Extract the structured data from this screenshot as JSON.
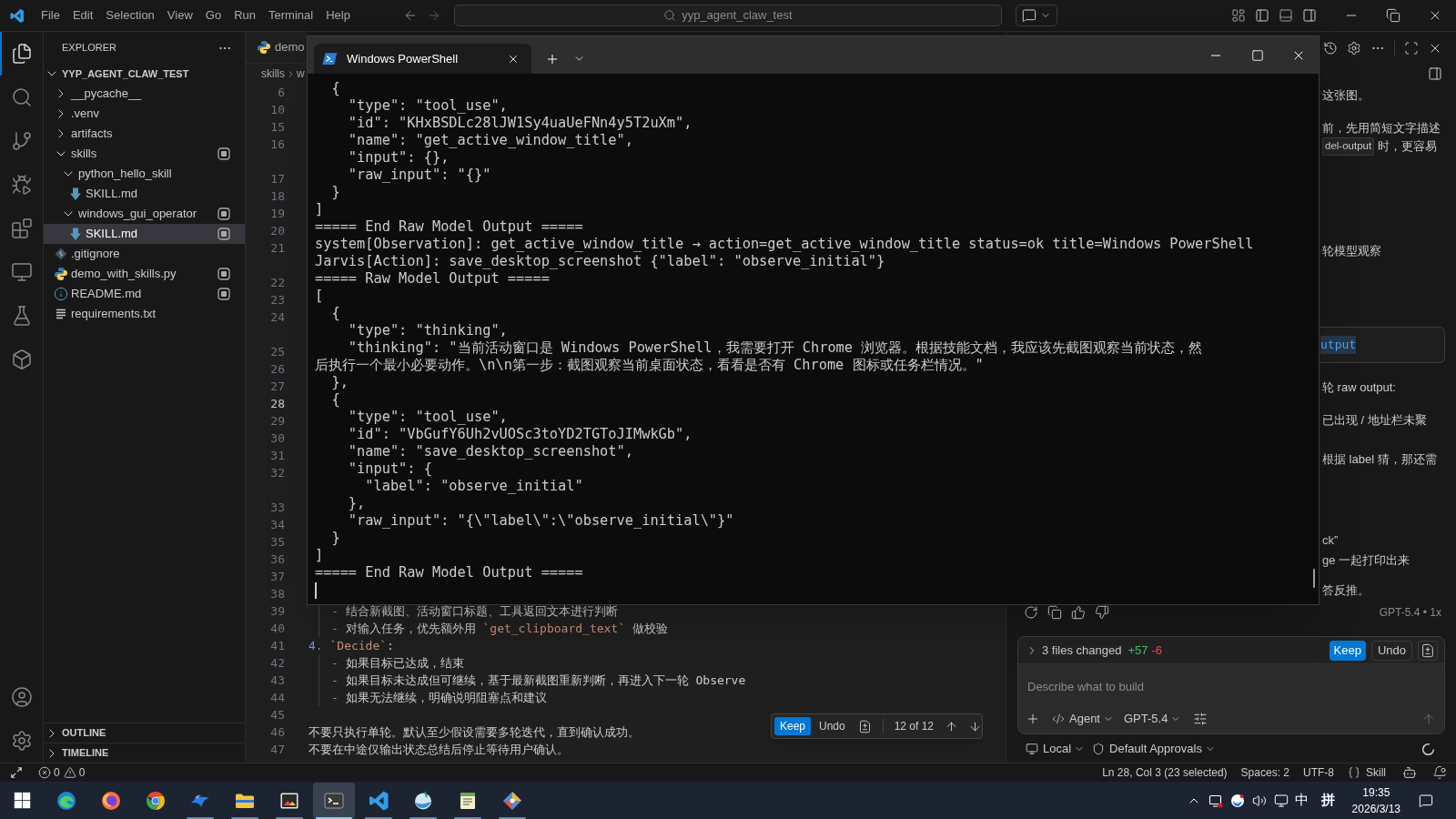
{
  "titlebar": {
    "menu": [
      "File",
      "Edit",
      "Selection",
      "View",
      "Go",
      "Run",
      "Terminal",
      "Help"
    ],
    "search": "yyp_agent_claw_test"
  },
  "activity_bar": [
    {
      "selected": true
    },
    {
      "selected": false
    },
    {
      "selected": false
    },
    {
      "selected": false
    },
    {
      "selected": false
    },
    {
      "selected": false
    },
    {
      "selected": false
    },
    {
      "selected": false
    }
  ],
  "explorer": {
    "title": "EXPLORER",
    "root": {
      "label": "YYP_AGENT_CLAW_TEST",
      "expanded": true
    },
    "items": [
      {
        "label": "__pycache__",
        "kind": "folder",
        "expanded": false,
        "selected": false,
        "badge": false
      },
      {
        "label": ".venv",
        "kind": "folder",
        "expanded": false,
        "selected": false,
        "badge": false
      },
      {
        "label": "artifacts",
        "kind": "folder",
        "expanded": false,
        "selected": false,
        "badge": false
      },
      {
        "label": "skills",
        "kind": "folder",
        "expanded": true,
        "selected": false,
        "badge": true,
        "children": [
          {
            "label": "python_hello_skill",
            "kind": "folder",
            "expanded": true,
            "selected": false,
            "badge": false,
            "children": [
              {
                "label": "SKILL.md",
                "kind": "markdown",
                "selected": false,
                "badge": false
              }
            ]
          },
          {
            "label": "windows_gui_operator",
            "kind": "folder",
            "expanded": true,
            "selected": false,
            "badge": true,
            "children": [
              {
                "label": "SKILL.md",
                "kind": "markdown",
                "selected": true,
                "badge": true
              }
            ]
          }
        ]
      },
      {
        "label": ".gitignore",
        "kind": "git",
        "selected": false,
        "badge": false
      },
      {
        "label": "demo_with_skills.py",
        "kind": "python",
        "selected": false,
        "badge": true
      },
      {
        "label": "README.md",
        "kind": "info",
        "selected": false,
        "badge": true
      },
      {
        "label": "requirements.txt",
        "kind": "text",
        "selected": false,
        "badge": false
      }
    ],
    "sections": [
      {
        "label": "OUTLINE",
        "expanded": false
      },
      {
        "label": "TIMELINE",
        "expanded": false
      }
    ]
  },
  "editor": {
    "tab": "demo",
    "breadcrumb": [
      "skills",
      "w"
    ],
    "rows": [
      {
        "kind": "line",
        "number": "6",
        "current": false
      },
      {
        "kind": "line",
        "number": "10",
        "current": false
      },
      {
        "kind": "line",
        "number": "15",
        "current": false
      },
      {
        "kind": "line",
        "number": "16",
        "current": false
      },
      {
        "kind": "wrap"
      },
      {
        "kind": "line",
        "number": "17",
        "current": false
      },
      {
        "kind": "line",
        "number": "18",
        "current": false
      },
      {
        "kind": "line",
        "number": "19",
        "current": false
      },
      {
        "kind": "line",
        "number": "20",
        "current": false
      },
      {
        "kind": "line",
        "number": "21",
        "current": false
      },
      {
        "kind": "wrap"
      },
      {
        "kind": "line",
        "number": "22",
        "current": false
      },
      {
        "kind": "line",
        "number": "23",
        "current": false
      },
      {
        "kind": "line",
        "number": "24",
        "current": false
      },
      {
        "kind": "wrap"
      },
      {
        "kind": "line",
        "number": "25",
        "current": false
      },
      {
        "kind": "line",
        "number": "26",
        "current": false
      },
      {
        "kind": "line",
        "number": "27",
        "current": false
      },
      {
        "kind": "line",
        "number": "28",
        "current": true
      },
      {
        "kind": "line",
        "number": "29",
        "current": false
      },
      {
        "kind": "line",
        "number": "30",
        "current": false
      },
      {
        "kind": "line",
        "number": "31",
        "current": false
      },
      {
        "kind": "line",
        "number": "32",
        "current": false
      },
      {
        "kind": "wrap"
      },
      {
        "kind": "line",
        "number": "33",
        "current": false
      },
      {
        "kind": "line",
        "number": "34",
        "current": false
      },
      {
        "kind": "line",
        "number": "35",
        "current": false
      },
      {
        "kind": "line",
        "number": "36",
        "current": false
      },
      {
        "kind": "line",
        "number": "37",
        "current": false
      },
      {
        "kind": "line",
        "number": "38",
        "current": false
      },
      {
        "kind": "text",
        "number": "39",
        "current": false,
        "indented": true,
        "segments": [
          {
            "kind": "marker",
            "text": "- "
          },
          {
            "kind": "plain",
            "text": "结合新截图、活动窗口标题、工具返回文本进行判断"
          }
        ]
      },
      {
        "kind": "text",
        "number": "40",
        "current": false,
        "indented": true,
        "segments": [
          {
            "kind": "marker",
            "text": "- "
          },
          {
            "kind": "plain",
            "text": "对输入任务，优先额外用 "
          },
          {
            "kind": "code",
            "text": "`get_clipboard_text`"
          },
          {
            "kind": "plain",
            "text": " 做校验"
          }
        ]
      },
      {
        "kind": "text",
        "number": "41",
        "current": false,
        "indented": false,
        "segments": [
          {
            "kind": "marker",
            "text": "4. "
          },
          {
            "kind": "code",
            "text": "`Decide`"
          },
          {
            "kind": "plain",
            "text": ":"
          }
        ]
      },
      {
        "kind": "text",
        "number": "42",
        "current": false,
        "indented": true,
        "segments": [
          {
            "kind": "marker",
            "text": "- "
          },
          {
            "kind": "plain",
            "text": "如果目标已达成，结束"
          }
        ]
      },
      {
        "kind": "text",
        "number": "43",
        "current": false,
        "indented": true,
        "segments": [
          {
            "kind": "marker",
            "text": "- "
          },
          {
            "kind": "plain",
            "text": "如果目标未达成但可继续，基于最新截图重新判断，再进入下一轮 Observe"
          }
        ]
      },
      {
        "kind": "text",
        "number": "44",
        "current": false,
        "indented": true,
        "segments": [
          {
            "kind": "marker",
            "text": "- "
          },
          {
            "kind": "plain",
            "text": "如果无法继续，明确说明阻塞点和建议"
          }
        ]
      },
      {
        "kind": "line",
        "number": "45",
        "current": false
      },
      {
        "kind": "text",
        "number": "46",
        "current": false,
        "indented": false,
        "segments": [
          {
            "kind": "plain",
            "text": "不要只执行单轮。默认至少假设需要多轮迭代，直到确认成功。"
          }
        ]
      },
      {
        "kind": "text",
        "number": "47",
        "current": false,
        "indented": false,
        "segments": [
          {
            "kind": "plain",
            "text": "不要在中途仅输出状态总结后停止等待用户确认。"
          }
        ]
      }
    ],
    "diff_nav": {
      "keep": "Keep",
      "undo": "Undo",
      "position": "12 of 12"
    }
  },
  "terminal": {
    "tab": "Windows PowerShell",
    "lines": [
      "  {",
      "    \"type\": \"tool_use\",",
      "    \"id\": \"KHxBSDLc28lJW1Sy4uaUeFNn4y5T2uXm\",",
      "    \"name\": \"get_active_window_title\",",
      "    \"input\": {},",
      "    \"raw_input\": \"{}\"",
      "  }",
      "]",
      "===== End Raw Model Output =====",
      "system[Observation]: get_active_window_title → action=get_active_window_title status=ok title=Windows PowerShell",
      "Jarvis[Action]: save_desktop_screenshot {\"label\": \"observe_initial\"}",
      "===== Raw Model Output =====",
      "[",
      "  {",
      "    \"type\": \"thinking\",",
      "    \"thinking\": \"当前活动窗口是 Windows PowerShell，我需要打开 Chrome 浏览器。根据技能文档，我应该先截图观察当前状态，然",
      "后执行一个最小必要动作。\\n\\n第一步：截图观察当前桌面状态，看看是否有 Chrome 图标或任务栏情况。\"",
      "  },",
      "  {",
      "    \"type\": \"tool_use\",",
      "    \"id\": \"VbGufY6Uh2vUOSc3toYD2TGToJIMwkGb\",",
      "    \"name\": \"save_desktop_screenshot\",",
      "    \"input\": {",
      "      \"label\": \"observe_initial\"",
      "    },",
      "    \"raw_input\": \"{\\\"label\\\":\\\"observe_initial\\\"}\"",
      "  }",
      "]",
      "===== End Raw Model Output ====="
    ],
    "cursor": true
  },
  "chat": {
    "messages": [
      {
        "kind": "text",
        "text": "这张图。"
      },
      {
        "kind": "text",
        "text": "前，先用简短文字描述"
      },
      {
        "kind": "text",
        "segments": [
          {
            "kind": "code",
            "text": "del-output"
          },
          {
            "kind": "plain",
            "text": " 时，更容易"
          }
        ]
      },
      {
        "kind": "text",
        "text": "轮模型观察"
      },
      {
        "kind": "code_block",
        "text": "utput"
      },
      {
        "kind": "text",
        "text": "轮 raw output:"
      },
      {
        "kind": "text",
        "text": "已出现 / 地址栏未聚"
      },
      {
        "kind": "text",
        "text": "根据 label 猜，那还需"
      },
      {
        "kind": "text",
        "text": "ck”"
      },
      {
        "kind": "text",
        "text": "ge 一起打印出来"
      },
      {
        "kind": "text",
        "text": "答反推。"
      }
    ],
    "model_info": "GPT-5.4 • 1x",
    "changes": {
      "expanded": false,
      "summary": "3 files changed",
      "added": "+57",
      "removed": "-6",
      "keep": "Keep",
      "undo": "Undo"
    },
    "input": {
      "placeholder": "Describe what to build"
    },
    "mode": "Agent",
    "model": "GPT-5.4",
    "location": "Local",
    "approvals": "Default Approvals"
  },
  "status_bar": {
    "errors": "0",
    "warnings": "0",
    "position": "Ln 28, Col 3 (23 selected)",
    "indent": "Spaces: 2",
    "encoding": "UTF-8",
    "language": "Skill"
  },
  "taskbar": {
    "apps": [
      {
        "selected": false,
        "running": false
      },
      {
        "selected": false,
        "running": false
      },
      {
        "selected": false,
        "running": false
      },
      {
        "selected": false,
        "running": true
      },
      {
        "selected": false,
        "running": true
      },
      {
        "selected": false,
        "running": true
      },
      {
        "selected": true,
        "running": true
      },
      {
        "selected": false,
        "running": true
      },
      {
        "selected": false,
        "running": true
      },
      {
        "selected": false,
        "running": true
      },
      {
        "selected": false,
        "running": true
      }
    ],
    "tray": {
      "ime_language": "中",
      "ime_mode": "拼",
      "time": "19:35",
      "date": "2026/3/13"
    }
  }
}
